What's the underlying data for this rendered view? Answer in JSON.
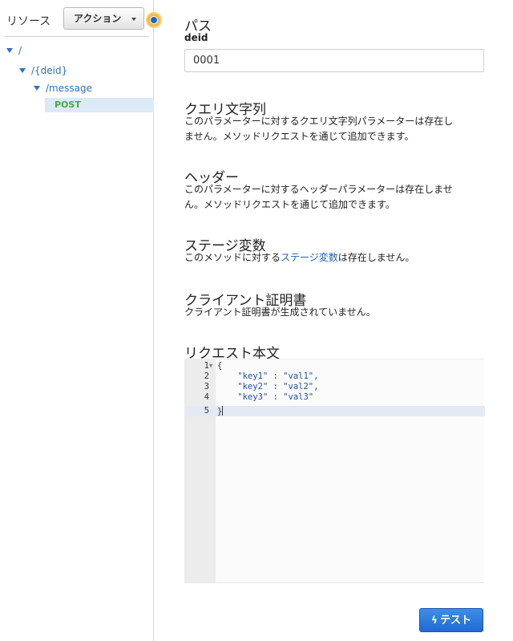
{
  "resources_panel": {
    "label": "リソース",
    "action_button": "アクション",
    "tree": {
      "root": "/",
      "deid": "/{deid}",
      "message": "/message",
      "method": "POST"
    }
  },
  "path_section": {
    "title": "パス",
    "param_name": "deid",
    "param_value": "0001"
  },
  "query_section": {
    "title": "クエリ文字列",
    "desc_line1": "このパラメーターに対するクエリ文字列パラメーターは存在し",
    "desc_line2": "ません。メソッドリクエストを通じて追加できます。"
  },
  "header_section": {
    "title": "ヘッダー",
    "desc_line1": "このパラメーターに対するヘッダーパラメーターは存在しませ",
    "desc_line2": "ん。メソッドリクエストを通じて追加できます。"
  },
  "stage_section": {
    "title": "ステージ変数",
    "desc_before": "このメソッドに対する",
    "desc_link": "ステージ変数",
    "desc_after": "は存在しません。"
  },
  "cert_section": {
    "title": "クライアント証明書",
    "desc": "クライアント証明書が生成されていません。"
  },
  "body_section": {
    "title": "リクエスト本文",
    "code_lines": [
      {
        "num": "1",
        "text": "{"
      },
      {
        "num": "2",
        "text": "    \"key1\" : \"val1\","
      },
      {
        "num": "3",
        "text": "    \"key2\" : \"val2\","
      },
      {
        "num": "4",
        "text": "    \"key3\" : \"val3\""
      },
      {
        "num": "5",
        "text": "}"
      }
    ]
  },
  "test_button": "テスト"
}
